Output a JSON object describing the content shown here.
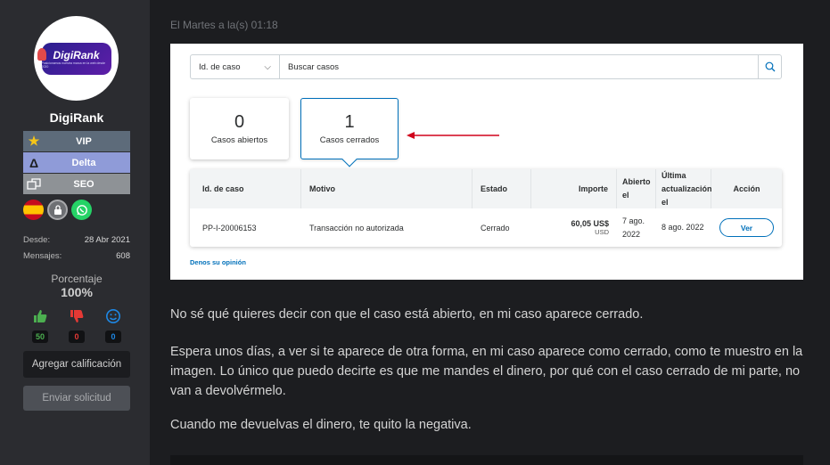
{
  "sidebar": {
    "logo_text": "DigiRank",
    "logo_sub": "Posicionamos nuestra marca en la web desde 2020",
    "username": "DigiRank",
    "badges": [
      {
        "label": "VIP",
        "icon": "star-icon"
      },
      {
        "label": "Delta",
        "icon": "delta-icon"
      },
      {
        "label": "SEO",
        "icon": "seo-icon"
      }
    ],
    "icons": [
      "spain-flag-icon",
      "lock-icon",
      "whatsapp-icon"
    ],
    "stats": {
      "since_label": "Desde:",
      "since_value": "28 Abr 2021",
      "messages_label": "Mensajes:",
      "messages_value": "608"
    },
    "percentage_label": "Porcentaje",
    "percentage_value": "100%",
    "votes": {
      "positive": "50",
      "negative": "0",
      "neutral": "0"
    },
    "rate_button": "Agregar calificación",
    "send_button": "Enviar solicitud"
  },
  "post": {
    "date": "El Martes a la(s) 01:18",
    "screenshot": {
      "search_select": "Id. de caso",
      "search_placeholder": "Buscar casos",
      "open_count": "0",
      "open_label": "Casos abiertos",
      "closed_count": "1",
      "closed_label": "Casos cerrados",
      "headers": {
        "id": "Id. de caso",
        "reason": "Motivo",
        "status": "Estado",
        "amount": "Importe",
        "opened": "Abierto el",
        "updated": "Última actualización el",
        "action": "Acción"
      },
      "row": {
        "id": "PP-I-20006153",
        "reason": "Transacción no autorizada",
        "status": "Cerrado",
        "amount": "60,05 US$",
        "currency": "USD",
        "opened": "7 ago. 2022",
        "updated": "8 ago. 2022",
        "action": "Ver"
      },
      "feedback": "Denos su opinión",
      "arrow_color": "#d0021b"
    },
    "paragraphs": [
      "No sé qué quieres decir con que el caso está abierto, en mi caso aparece cerrado.",
      "Espera unos días, a ver si te aparece de otra forma, en mi caso aparece como cerrado, como te muestro en la imagen. Lo único que puedo decirte es que me mandes el dinero, por qué con el caso cerrado de mi parte, no van a devolvérmelo.",
      "Cuando me devuelvas el dinero, te quito la negativa."
    ]
  },
  "colors": {
    "accent": "#0070ba",
    "positive": "#4caf50",
    "negative": "#e53935",
    "neutral": "#1e88e5"
  }
}
